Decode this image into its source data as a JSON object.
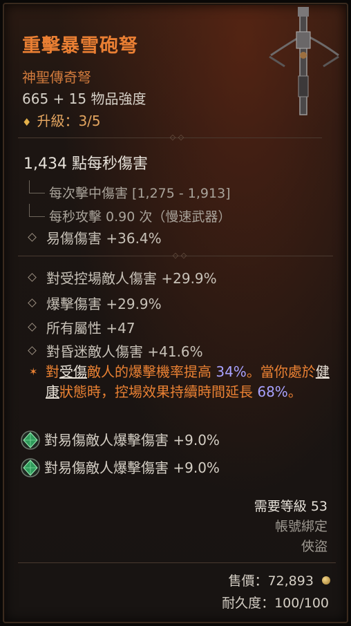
{
  "item": {
    "name": "重擊暴雪砲弩",
    "rarity": "神聖傳奇弩",
    "item_power": "665 + 15 物品強度",
    "upgrade": "升級：3/5",
    "upgrade_icon": "diamond-icon",
    "weapon_icon": "crossbow-icon"
  },
  "damage": {
    "dps": "1,434 點每秒傷害",
    "per_hit": "每次擊中傷害 [1,275 - 1,913]",
    "attack_speed": "每秒攻擊 0.90 次（慢速武器）",
    "implicit": "易傷傷害 +36.4%"
  },
  "affixes": [
    "對受控場敵人傷害 +29.9%",
    "爆擊傷害 +29.9%",
    "所有屬性 +47",
    "對昏迷敵人傷害 +41.6%"
  ],
  "legendary": {
    "p1": "對",
    "kw1": "受傷",
    "p2": "敵人的爆擊機率提高 ",
    "n1": "34%",
    "p3": "。當你處於",
    "kw2": "健康",
    "p4": "狀態時，控場效果持續時間延長 ",
    "n2": "68%",
    "p5": "。"
  },
  "gems": [
    {
      "text": "對易傷敵人爆擊傷害 +9.0%",
      "icon": "emerald-gem-icon"
    },
    {
      "text": "對易傷敵人爆擊傷害 +9.0%",
      "icon": "emerald-gem-icon"
    }
  ],
  "requirements": {
    "level": "需要等級 53",
    "bind": "帳號綁定",
    "class": "俠盜"
  },
  "footer": {
    "price": "售價：72,893",
    "gold_icon": "gold-coin-icon",
    "durability": "耐久度：100/100"
  },
  "colors": {
    "title": "#ea7f33",
    "legendary_text": "#ea8133",
    "value_highlight": "#a8a2ff",
    "gem": "#3fb36a"
  }
}
